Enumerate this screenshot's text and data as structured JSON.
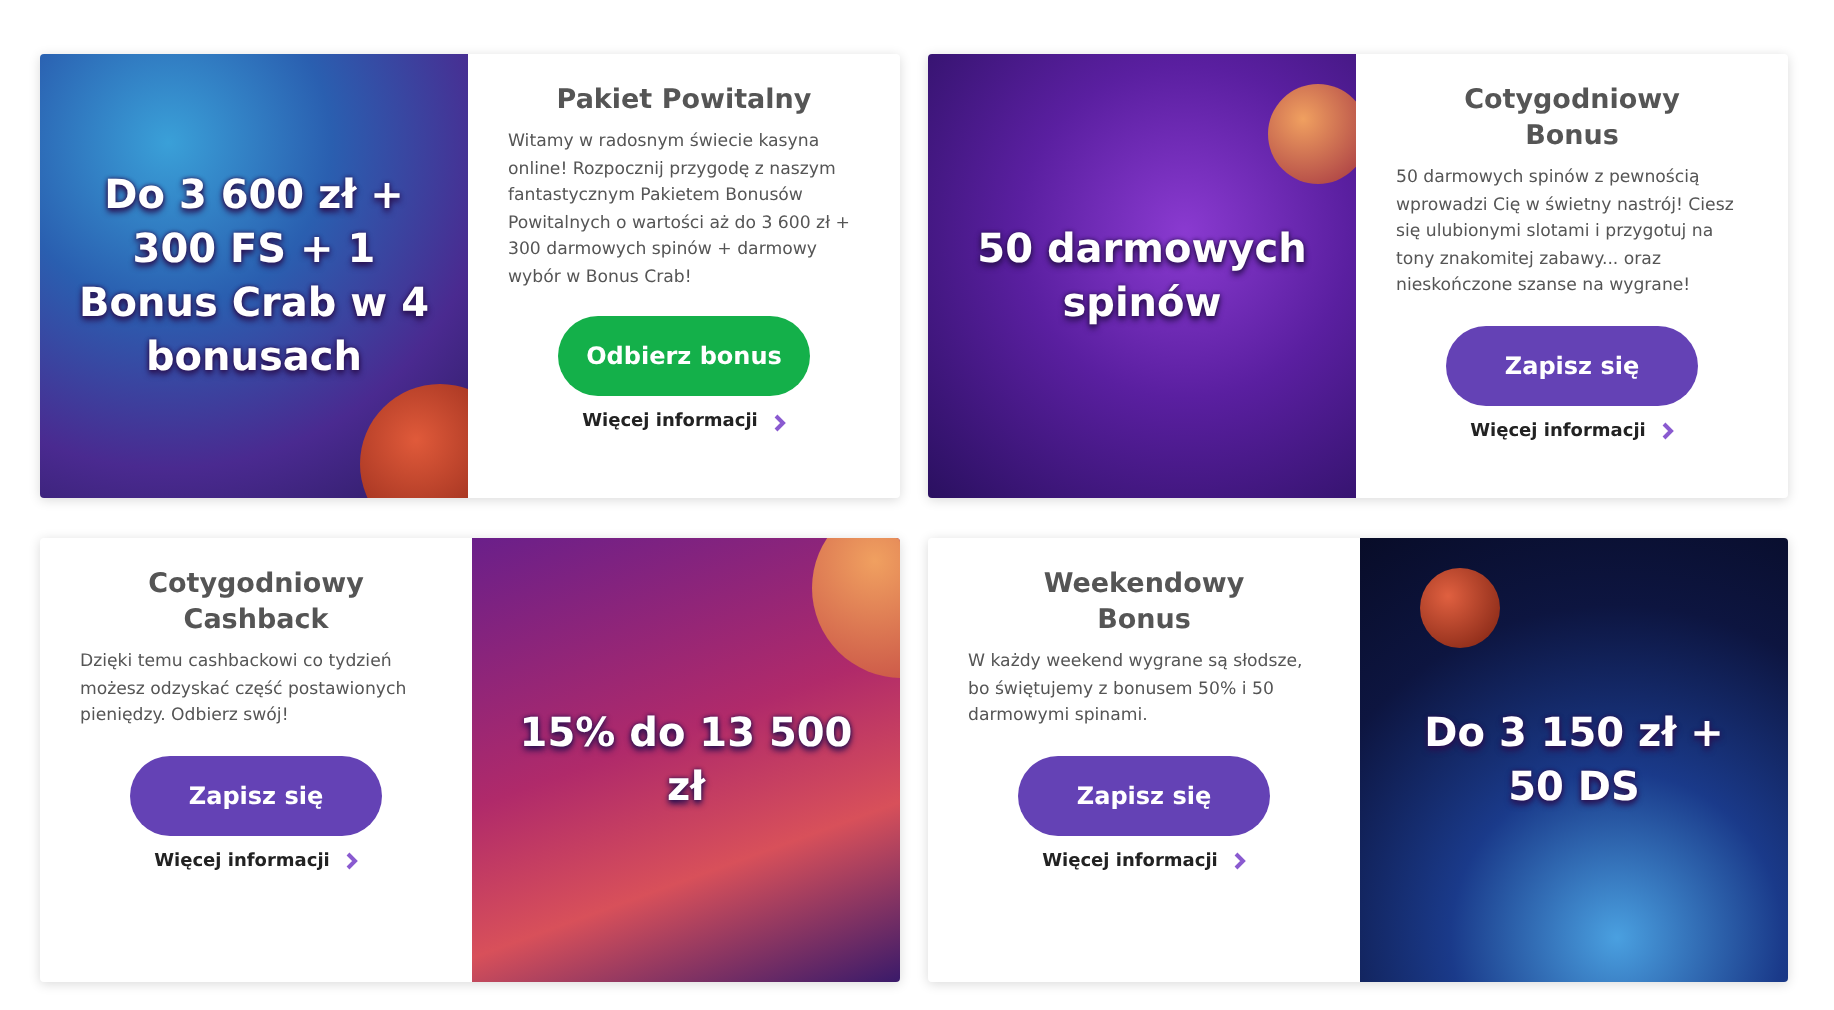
{
  "cards": [
    {
      "image_on_right": false,
      "banner_headline": "Do 3 600 zł + 300 FS + 1 Bonus Crab w 4 bonusach",
      "title": "Pakiet Powitalny",
      "description": "Witamy w radosnym świecie kasyna online! Rozpocznij przygodę z naszym fantastycznym Pakietem Bonusów Powitalnych o wartości aż do 3 600 zł + 300 darmowych spinów + darmowy wybór w Bonus Crab!",
      "button": {
        "label": "Odbierz bonus",
        "kind": "claim"
      },
      "more_link": "Więcej informacji"
    },
    {
      "image_on_right": false,
      "banner_headline": "50 darmowych spinów",
      "title": "Cotygodniowy Bonus",
      "description": "50 darmowych spinów z pewnością wprowadzi Cię w świetny nastrój! Ciesz się ulubionymi slotami i przygotuj na tony znakomitej zabawy... oraz nieskończone szanse na wygrane!",
      "button": {
        "label": "Zapisz się",
        "kind": "signup"
      },
      "more_link": "Więcej informacji"
    },
    {
      "image_on_right": true,
      "banner_headline": "15% do 13 500 zł",
      "title": "Cotygodniowy Cashback",
      "description": "Dzięki temu cashbackowi co tydzień możesz odzyskać część postawionych pieniędzy. Odbierz swój!",
      "button": {
        "label": "Zapisz się",
        "kind": "signup"
      },
      "more_link": "Więcej informacji"
    },
    {
      "image_on_right": true,
      "banner_headline": "Do 3 150 zł + 50 DS",
      "title": "Weekendowy Bonus",
      "description": "W każdy weekend wygrane są słodsze, bo świętujemy z bonusem 50% i 50 darmowymi spinami.",
      "button": {
        "label": "Zapisz się",
        "kind": "signup"
      },
      "more_link": "Więcej informacji"
    }
  ]
}
